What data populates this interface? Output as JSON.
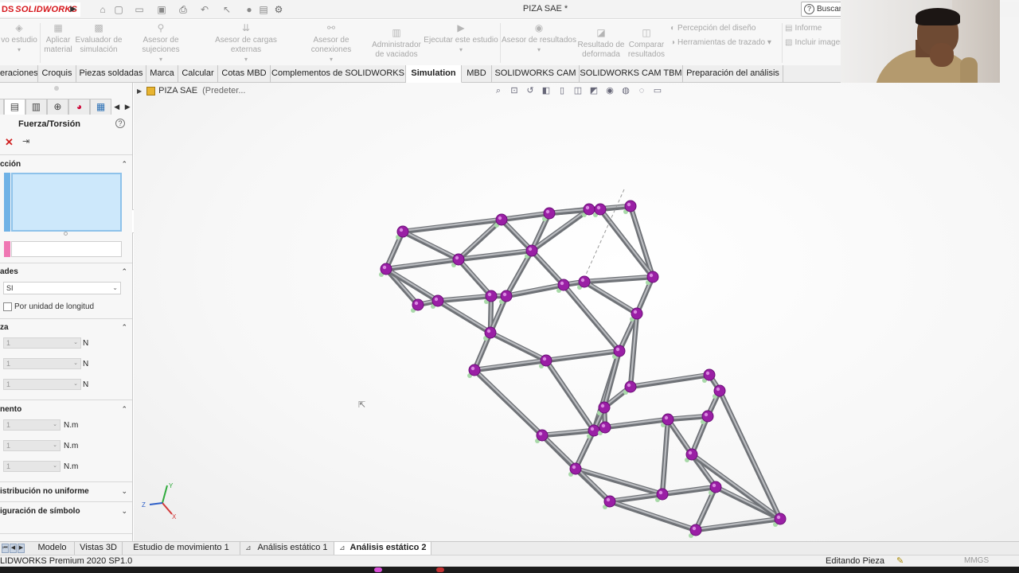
{
  "app": {
    "logo_ds": "DS",
    "logo_brand": "SOLIDWORKS",
    "document_title": "PIZA SAE *",
    "search_label": "Buscar"
  },
  "ribbon": {
    "commands": [
      {
        "label_line1": "vo estudio",
        "label_line2": "",
        "icon": "new-study-icon"
      },
      {
        "label_line1": "Aplicar",
        "label_line2": "material",
        "icon": "apply-material-icon"
      },
      {
        "label_line1": "Evaluador de",
        "label_line2": "simulación",
        "icon": "simulation-advisor-icon"
      },
      {
        "label_line1": "Asesor de sujeciones",
        "label_line2": "",
        "icon": "fixtures-advisor-icon"
      },
      {
        "label_line1": "Asesor de cargas externas",
        "label_line2": "",
        "icon": "external-loads-advisor-icon"
      },
      {
        "label_line1": "Asesor de conexiones",
        "label_line2": "",
        "icon": "connections-advisor-icon"
      },
      {
        "label_line1": "Administrador",
        "label_line2": "de vaciados",
        "icon": "shell-manager-icon"
      },
      {
        "label_line1": "Ejecutar este estudio",
        "label_line2": "",
        "icon": "run-study-icon"
      },
      {
        "label_line1": "Asesor de resultados",
        "label_line2": "",
        "icon": "results-advisor-icon"
      },
      {
        "label_line1": "Resultado de",
        "label_line2": "deformada",
        "icon": "deformed-result-icon"
      },
      {
        "label_line1": "Comparar",
        "label_line2": "resultados",
        "icon": "compare-results-icon"
      }
    ],
    "row_commands": [
      {
        "label": "Percepción del diseño",
        "icon": "design-insight-icon"
      },
      {
        "label": "Herramientas de trazado",
        "icon": "plot-tools-icon"
      },
      {
        "label": "Informe",
        "icon": "report-icon"
      },
      {
        "label": "Incluir imagen",
        "icon": "include-image-icon"
      }
    ]
  },
  "tabs": [
    {
      "label": "eraciones",
      "active": false
    },
    {
      "label": "Croquis",
      "active": false
    },
    {
      "label": "Piezas soldadas",
      "active": false
    },
    {
      "label": "Marca",
      "active": false
    },
    {
      "label": "Calcular",
      "active": false
    },
    {
      "label": "Cotas MBD",
      "active": false
    },
    {
      "label": "Complementos de SOLIDWORKS",
      "active": false
    },
    {
      "label": "Simulation",
      "active": true
    },
    {
      "label": "MBD",
      "active": false
    },
    {
      "label": "SOLIDWORKS CAM",
      "active": false
    },
    {
      "label": "SOLIDWORKS CAM TBM",
      "active": false
    },
    {
      "label": "Preparación del análisis",
      "active": false
    }
  ],
  "property_manager": {
    "title": "Fuerza/Torsión",
    "help_glyph": "?",
    "sections": {
      "selection": "cción",
      "units": "ades",
      "force": "za",
      "moment": "nento",
      "nonuniform": "istribución no uniforme",
      "symbol": "iguración de símbolo"
    },
    "units_value": "SI",
    "per_unit_length": "Por unidad de longitud",
    "force_fields": [
      {
        "value": "1",
        "unit": "N"
      },
      {
        "value": "1",
        "unit": "N"
      },
      {
        "value": "1",
        "unit": "N"
      }
    ],
    "moment_fields": [
      {
        "value": "1",
        "unit": "N.m"
      },
      {
        "value": "1",
        "unit": "N.m"
      },
      {
        "value": "1",
        "unit": "N.m"
      }
    ]
  },
  "graphics": {
    "tree_part": "PIZA SAE",
    "tree_config": "(Predeter..."
  },
  "bottom_tabs": [
    {
      "label": "Modelo",
      "active": false
    },
    {
      "label": "Vistas 3D",
      "active": false
    },
    {
      "label": "Estudio de movimiento 1",
      "active": false
    },
    {
      "label": "Análisis estático 1",
      "active": false
    },
    {
      "label": "Análisis estático 2",
      "active": true
    }
  ],
  "status": {
    "product": "LIDWORKS Premium 2020 SP1.0",
    "editing": "Editando Pieza",
    "units": "MMGS"
  },
  "colors": {
    "brand_red": "#d6161b",
    "joint_magenta": "#9a1fa5",
    "beam_gray": "#8d8f94",
    "selection_blue": "#cde8fb",
    "direction_pink": "#ef77b3"
  }
}
